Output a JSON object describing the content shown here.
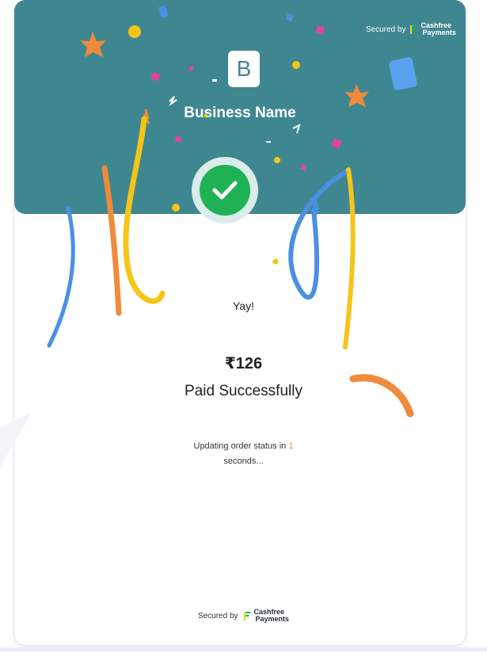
{
  "header": {
    "secured_by": "Secured by",
    "brand_line1": "Cashfree",
    "brand_line2": "Payments",
    "logo_letter": "B",
    "business_name": "Business Name"
  },
  "result": {
    "greeting": "Yay!",
    "amount": "₹126",
    "message": "Paid Successfully",
    "status_prefix": "Updating order status in ",
    "countdown": "1",
    "status_suffix": "seconds..."
  },
  "footer": {
    "secured_by": "Secured by",
    "brand_line1": "Cashfree",
    "brand_line2": "Payments"
  },
  "colors": {
    "header_bg": "#3f8790",
    "success_green": "#1fb255",
    "accent_orange": "#f08a3c"
  },
  "icons": {
    "logo": "cashfree-logo-icon",
    "check": "check-icon"
  }
}
